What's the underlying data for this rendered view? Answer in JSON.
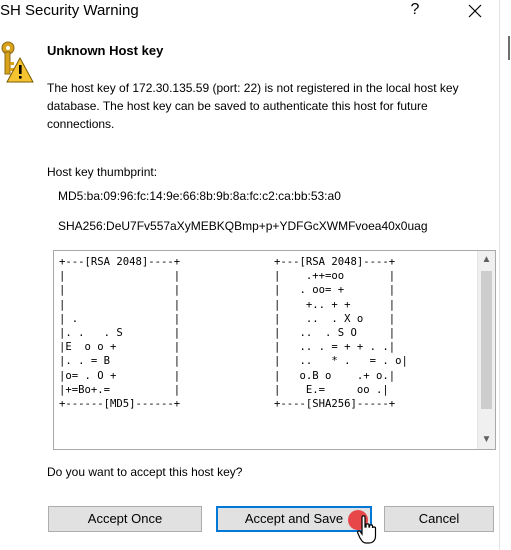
{
  "window": {
    "title": "SH Security Warning",
    "help_label": "?"
  },
  "heading": "Unknown Host key",
  "message": "The host key of 172.30.135.59 (port: 22) is not registered in the local host key database. The host key can be saved to authenticate this host for future connections.",
  "thumbprint": {
    "label": "Host key thumbprint:",
    "md5": "MD5:ba:09:96:fc:14:9e:66:8b:9b:8a:fc:c2:ca:bb:53:a0",
    "sha256": "SHA256:DeU7Fv557aXyMEBKQBmp+p+YDFGcXWMFvoea40x0uag"
  },
  "randomart": {
    "md5": "+---[RSA 2048]----+\n|                 |\n|                 |\n|                 |\n| .               |\n|. .   . S        |\n|E  o o +         |\n|. . = B          |\n|o= . O +         |\n|+=Bo+.=          |\n+------[MD5]------+",
    "sha256": "+---[RSA 2048]----+\n|    .++=oo       |\n|   . oo= +       |\n|    +.. + +      |\n|    ..  . X o    |\n|   ..  . S O     |\n|   .. . = + + . .|\n|   ..   * .   = . o|\n|   o.B o    .+ o.|\n|    E.=     oo .|\n+----[SHA256]-----+"
  },
  "question": "Do you want to accept this host key?",
  "buttons": {
    "accept_once": "Accept Once",
    "accept_save": "Accept and Save",
    "cancel": "Cancel"
  },
  "colors": {
    "focus_border": "#0078d7",
    "button_bg": "#e1e1e1",
    "click_marker": "#e8474a"
  }
}
